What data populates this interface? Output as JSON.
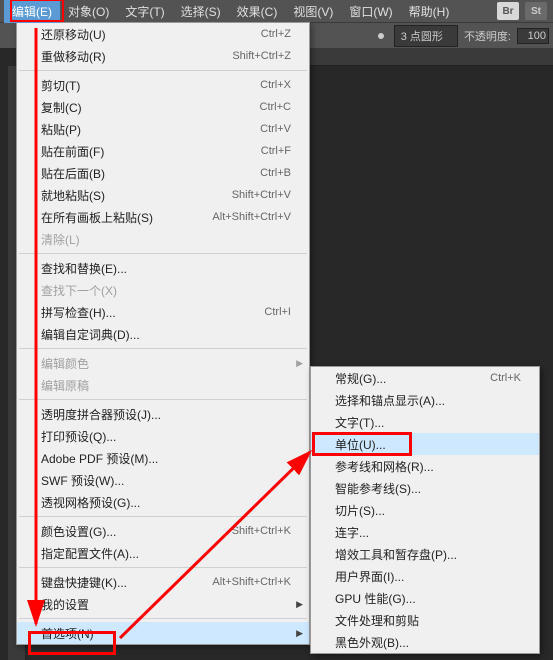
{
  "menubar": {
    "items": [
      {
        "label": "编辑(E)",
        "active": true
      },
      {
        "label": "对象(O)"
      },
      {
        "label": "文字(T)"
      },
      {
        "label": "选择(S)"
      },
      {
        "label": "效果(C)"
      },
      {
        "label": "视图(V)"
      },
      {
        "label": "窗口(W)"
      },
      {
        "label": "帮助(H)"
      }
    ],
    "badges": [
      "Br",
      "St"
    ]
  },
  "toolbar": {
    "stroke_label": "3 点圆形",
    "opacity_label": "不透明度:",
    "opacity_value": "100"
  },
  "edit_menu": [
    {
      "label": "还原移动(U)",
      "shortcut": "Ctrl+Z"
    },
    {
      "label": "重做移动(R)",
      "shortcut": "Shift+Ctrl+Z"
    },
    {
      "sep": true
    },
    {
      "label": "剪切(T)",
      "shortcut": "Ctrl+X"
    },
    {
      "label": "复制(C)",
      "shortcut": "Ctrl+C"
    },
    {
      "label": "粘贴(P)",
      "shortcut": "Ctrl+V"
    },
    {
      "label": "贴在前面(F)",
      "shortcut": "Ctrl+F"
    },
    {
      "label": "贴在后面(B)",
      "shortcut": "Ctrl+B"
    },
    {
      "label": "就地粘贴(S)",
      "shortcut": "Shift+Ctrl+V"
    },
    {
      "label": "在所有画板上粘贴(S)",
      "shortcut": "Alt+Shift+Ctrl+V"
    },
    {
      "label": "清除(L)",
      "disabled": true
    },
    {
      "sep": true
    },
    {
      "label": "查找和替换(E)..."
    },
    {
      "label": "查找下一个(X)",
      "disabled": true
    },
    {
      "label": "拼写检查(H)...",
      "shortcut": "Ctrl+I"
    },
    {
      "label": "编辑自定词典(D)..."
    },
    {
      "sep": true
    },
    {
      "label": "编辑颜色",
      "submenu": true,
      "disabled": true
    },
    {
      "label": "编辑原稿",
      "disabled": true
    },
    {
      "sep": true
    },
    {
      "label": "透明度拼合器预设(J)..."
    },
    {
      "label": "打印预设(Q)..."
    },
    {
      "label": "Adobe PDF 预设(M)..."
    },
    {
      "label": "SWF 预设(W)..."
    },
    {
      "label": "透视网格预设(G)..."
    },
    {
      "sep": true
    },
    {
      "label": "颜色设置(G)...",
      "shortcut": "Shift+Ctrl+K"
    },
    {
      "label": "指定配置文件(A)..."
    },
    {
      "sep": true
    },
    {
      "label": "键盘快捷键(K)...",
      "shortcut": "Alt+Shift+Ctrl+K"
    },
    {
      "label": "我的设置",
      "submenu": true
    },
    {
      "sep": true
    },
    {
      "label": "首选项(N)",
      "submenu": true,
      "hover": true
    }
  ],
  "prefs_menu": [
    {
      "label": "常规(G)...",
      "shortcut": "Ctrl+K"
    },
    {
      "label": "选择和锚点显示(A)..."
    },
    {
      "label": "文字(T)..."
    },
    {
      "label": "单位(U)...",
      "hover": true
    },
    {
      "label": "参考线和网格(R)..."
    },
    {
      "label": "智能参考线(S)..."
    },
    {
      "label": "切片(S)..."
    },
    {
      "label": "连字..."
    },
    {
      "label": "增效工具和暂存盘(P)..."
    },
    {
      "label": "用户界面(I)..."
    },
    {
      "label": "GPU 性能(G)..."
    },
    {
      "label": "文件处理和剪贴"
    },
    {
      "label": "黑色外观(B)..."
    }
  ]
}
